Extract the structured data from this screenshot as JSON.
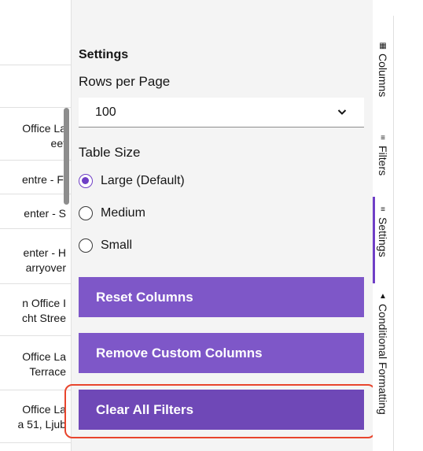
{
  "table": {
    "rows": [
      {
        "line1": "Office La",
        "line2": "eet"
      },
      {
        "line1": "entre - Fi",
        "line2": ""
      },
      {
        "line1": "enter - S",
        "line2": ""
      },
      {
        "line1": "enter - H",
        "line2": "arryover"
      },
      {
        "line1": "n Office I",
        "line2": "cht Stree"
      },
      {
        "line1": "Office La",
        "line2": "Terrace"
      },
      {
        "line1": "Office La",
        "line2": "a 51, Ljub"
      }
    ]
  },
  "settings": {
    "title": "Settings",
    "rows_per_page_label": "Rows per Page",
    "rows_per_page_value": "100",
    "table_size_label": "Table Size",
    "size_options": [
      {
        "label": "Large (Default)",
        "selected": true
      },
      {
        "label": "Medium",
        "selected": false
      },
      {
        "label": "Small",
        "selected": false
      }
    ],
    "buttons": {
      "reset": "Reset Columns",
      "remove_custom": "Remove Custom Columns",
      "clear_filters": "Clear All Filters"
    }
  },
  "side_tabs": [
    {
      "label": "Columns",
      "icon": "grid-icon",
      "active": false
    },
    {
      "label": "Filters",
      "icon": "filter-icon",
      "active": false
    },
    {
      "label": "Settings",
      "icon": "settings-icon",
      "active": true
    },
    {
      "label": "Conditional Formatting",
      "icon": "paint-bucket-icon",
      "active": false
    }
  ],
  "colors": {
    "accent": "#6f3fc6",
    "button": "#7e57c8",
    "highlight": "#e8452d"
  }
}
